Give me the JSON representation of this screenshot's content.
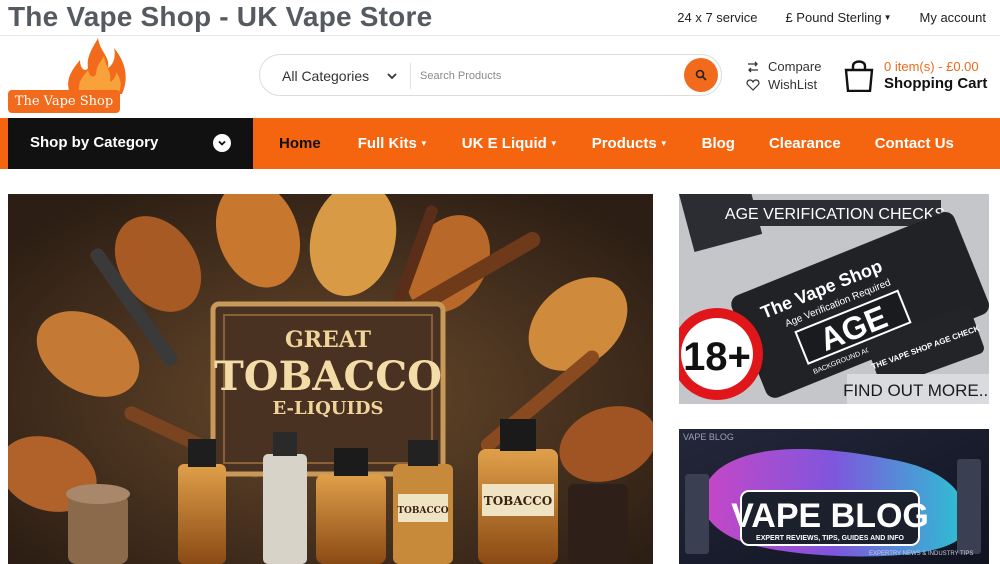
{
  "site_title": "The Vape Shop - UK Vape Store",
  "top_links": {
    "service": "24 x 7 service",
    "currency": "£ Pound Sterling",
    "account": "My account"
  },
  "logo_text": "The Vape Shop",
  "search": {
    "category": "All Categories",
    "placeholder": "Search Products"
  },
  "compare_label": "Compare",
  "wishlist_label": "WishList",
  "cart": {
    "count": "0 item(s) - £0.00",
    "label": "Shopping Cart"
  },
  "nav": {
    "shop_by_category": "Shop by Category",
    "items": [
      "Home",
      "Full Kits",
      "UK E Liquid",
      "Products",
      "Blog",
      "Clearance",
      "Contact Us"
    ]
  },
  "hero": {
    "line1": "GREAT",
    "line2": "TOBACCO",
    "line3": "E-LIQUIDS",
    "bottle_label1": "TOBACCO",
    "bottle_label2": "TOBACCO"
  },
  "age_banner": {
    "title": "AGE VERIFICATION CHECKS",
    "card_brand": "The Vape Shop",
    "card_line": "Age Verification Required",
    "card_big": "AGE",
    "card_sub": "BACKGROUND AGE VERIFICATION",
    "badge": "18+",
    "small_card": "THE VAPE SHOP AGE CHECK",
    "cta": "FIND OUT MORE..."
  },
  "blog_banner": {
    "title": "VAPE BLOG",
    "subtitle": "EXPERT REVIEWS, TIPS, GUIDES AND INFO",
    "corner": "VAPE BLOG",
    "news": "EXPERTRY NEWS & INDUSTRY TIPS"
  },
  "colors": {
    "accent": "#f5650f",
    "dark": "#111111"
  }
}
